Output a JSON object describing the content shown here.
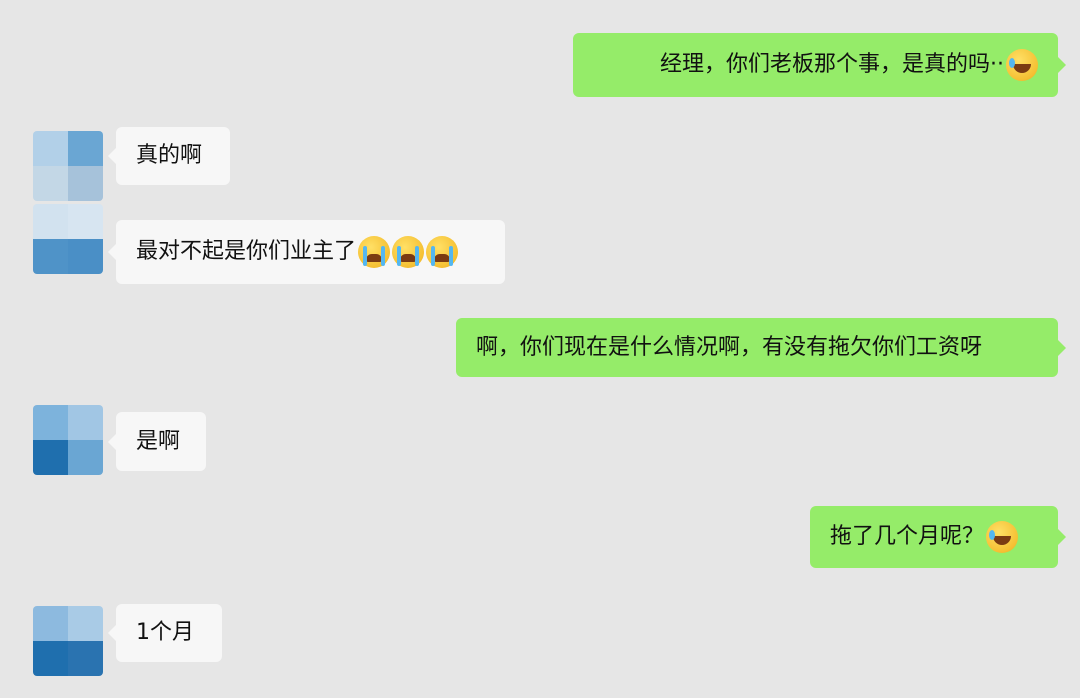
{
  "messages": [
    {
      "side": "out",
      "text": "经理，你们老板那个事，是真的吗··",
      "emoji": [
        "laugh-cry-emoji"
      ]
    },
    {
      "side": "in",
      "text": "真的啊",
      "emoji": []
    },
    {
      "side": "in",
      "text": "最对不起是你们业主了",
      "emoji": [
        "crying-emoji",
        "crying-emoji",
        "crying-emoji"
      ]
    },
    {
      "side": "out",
      "text": "啊，你们现在是什么情况啊，有没有拖欠你们工资呀",
      "emoji": []
    },
    {
      "side": "in",
      "text": "是啊",
      "emoji": []
    },
    {
      "side": "out",
      "text": "拖了几个月呢？",
      "emoji": [
        "laugh-cry-emoji"
      ]
    },
    {
      "side": "in",
      "text": "1个月",
      "emoji": []
    }
  ],
  "colors": {
    "background": "#e6e6e6",
    "incoming_bubble": "#f7f7f7",
    "outgoing_bubble": "#95ec69",
    "avatar_light": "#a9c9e3",
    "avatar_mid": "#6aa6d3",
    "avatar_dark": "#1f6fae"
  }
}
